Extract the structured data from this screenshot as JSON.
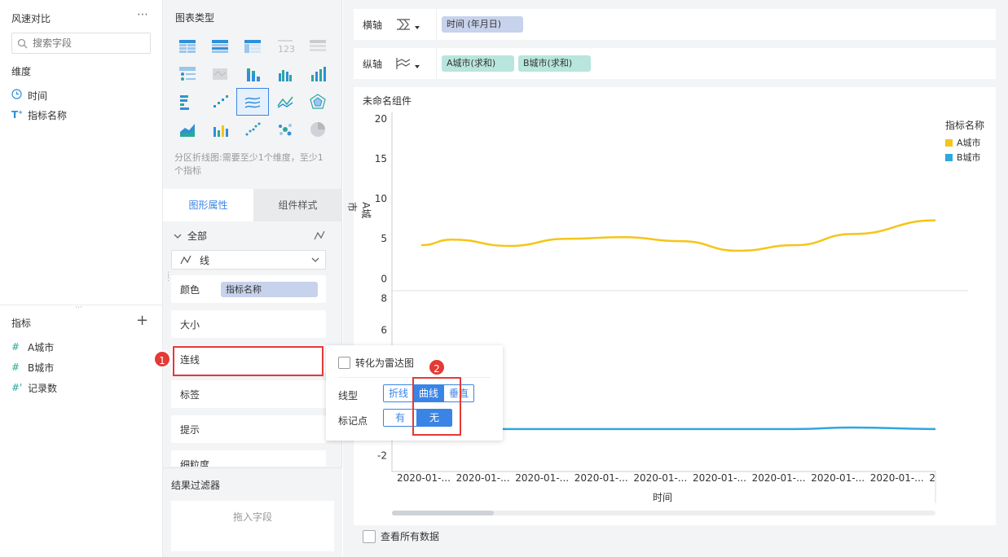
{
  "left": {
    "title": "风速对比",
    "more_icon": "more-dots-icon",
    "search_placeholder": "搜索字段",
    "dimension_header": "维度",
    "dimensions": [
      {
        "icon": "clock-icon",
        "label": "时间"
      },
      {
        "icon": "text-type-icon",
        "label": "指标名称"
      }
    ],
    "measure_header": "指标",
    "measures": [
      {
        "icon": "#",
        "label": "A城市"
      },
      {
        "icon": "#",
        "label": "B城市"
      },
      {
        "icon": "#'",
        "label": "记录数"
      }
    ]
  },
  "middle": {
    "chart_type_title": "图表类型",
    "chart_type_hint": "分区折线图:需要至少1个维度，至少1个指标",
    "tabs": [
      "图形属性",
      "组件样式"
    ],
    "active_tab": "图形属性",
    "all_label": "全部",
    "line_select": "线",
    "color_label": "颜色",
    "color_field": "指标名称",
    "props": [
      "大小",
      "连线",
      "标签",
      "提示",
      "细粒度"
    ],
    "result_filter_title": "结果过滤器",
    "drop_field": "拖入字段"
  },
  "axes_bar": {
    "x_label": "横轴",
    "x_field": "时间 (年月日)",
    "y_label": "纵轴",
    "y_fields": [
      "A城市(求和)",
      "B城市(求和)"
    ]
  },
  "component_name": "未命名组件",
  "popup": {
    "radar_checkbox": "转化为雷达图",
    "line_type_label": "线型",
    "line_types": [
      "折线",
      "曲线",
      "垂直"
    ],
    "line_type_selected": "曲线",
    "marker_label": "标记点",
    "markers": [
      "有",
      "无"
    ],
    "marker_selected": "无"
  },
  "annotations": {
    "badge1": "1",
    "badge2": "2"
  },
  "legend": {
    "title": "指标名称",
    "items": [
      {
        "name": "A城市",
        "color": "#f5c518"
      },
      {
        "name": "B城市",
        "color": "#2ea7e0"
      }
    ]
  },
  "view_all_data": "查看所有数据",
  "chart_data": {
    "type": "line",
    "xlabel": "时间",
    "x_tick_labels": [
      "2020-01-...",
      "2020-01-...",
      "2020-01-...",
      "2020-01-...",
      "2020-01-...",
      "2020-01-...",
      "2020-01-...",
      "2020-01-...",
      "2020-01-...",
      "2"
    ],
    "panels": [
      {
        "ylabel": "A城市",
        "yticks": [
          0,
          5,
          10,
          15,
          20
        ],
        "ylim": [
          -1.5,
          20
        ],
        "series": [
          {
            "name": "A城市",
            "color": "#f5c518",
            "values": [
              4.2,
              4.9,
              4.1,
              5.0,
              5.2,
              4.7,
              3.5,
              4.2,
              5.6,
              7.3
            ]
          }
        ]
      },
      {
        "ylabel": "",
        "yticks": [
          -2,
          4,
          6,
          8
        ],
        "ylim": [
          -3,
          8.5
        ],
        "series": [
          {
            "name": "B城市",
            "color": "#2ea7e0",
            "values": [
              -0.3,
              -0.3,
              -0.3,
              -0.3,
              -0.3,
              -0.3,
              -0.3,
              -0.3,
              -0.2,
              -0.3
            ]
          }
        ]
      }
    ],
    "curve": "smooth",
    "legend_position": "right"
  },
  "colors": {
    "accent": "#3a84e6",
    "annotation_red": "#e53935"
  }
}
